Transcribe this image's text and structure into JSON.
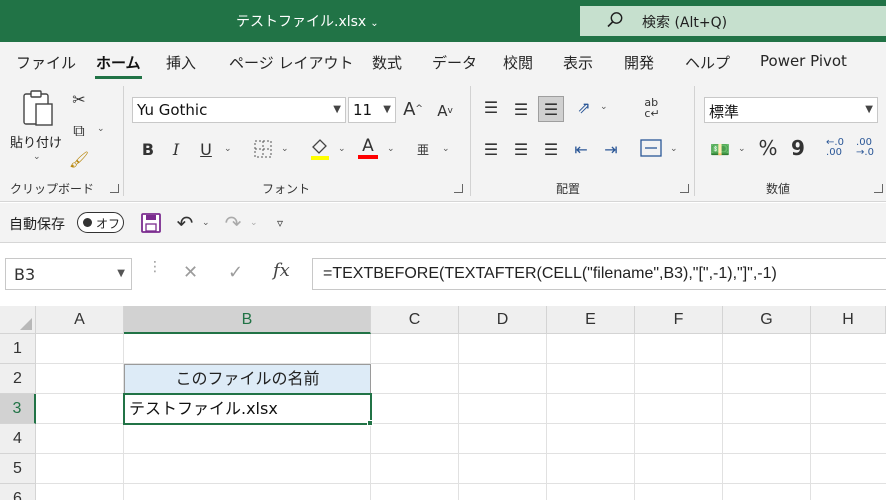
{
  "title_bar": {
    "filename": "テストファイル.xlsx",
    "search_placeholder": "検索 (Alt+Q)",
    "accent_color": "#217346"
  },
  "menu_tabs": [
    "ファイル",
    "ホーム",
    "挿入",
    "ページ レイアウト",
    "数式",
    "データ",
    "校閲",
    "表示",
    "開発",
    "ヘルプ",
    "Power Pivot"
  ],
  "active_tab": "ホーム",
  "ribbon": {
    "clipboard": {
      "paste_label": "貼り付け",
      "group_label": "クリップボード"
    },
    "font": {
      "font_name": "Yu Gothic",
      "font_size": "11",
      "bold": "B",
      "italic": "I",
      "underline": "U",
      "grow": "A",
      "shrink": "A",
      "phonetic": "亜",
      "font_color_letter": "A",
      "group_label": "フォント"
    },
    "alignment": {
      "group_label": "配置"
    },
    "number": {
      "format": "標準",
      "percent": "%",
      "comma": "9",
      "group_label": "数値"
    }
  },
  "quick_access": {
    "autosave_label": "自動保存",
    "toggle_label": "オフ"
  },
  "formula_bar": {
    "name_box": "B3",
    "fx_label": "fx",
    "formula": "=TEXTBEFORE(TEXTAFTER(CELL(\"filename\",B3),\"[\",-1),\"]\",-1)"
  },
  "sheet": {
    "columns": [
      "A",
      "B",
      "C",
      "D",
      "E",
      "F",
      "G",
      "H"
    ],
    "rows": [
      "1",
      "2",
      "3",
      "4",
      "5",
      "6"
    ],
    "cells": {
      "B2": "このファイルの名前",
      "B3": "テストファイル.xlsx"
    },
    "selected_cell": "B3",
    "header_fill": "#ddebf7"
  }
}
